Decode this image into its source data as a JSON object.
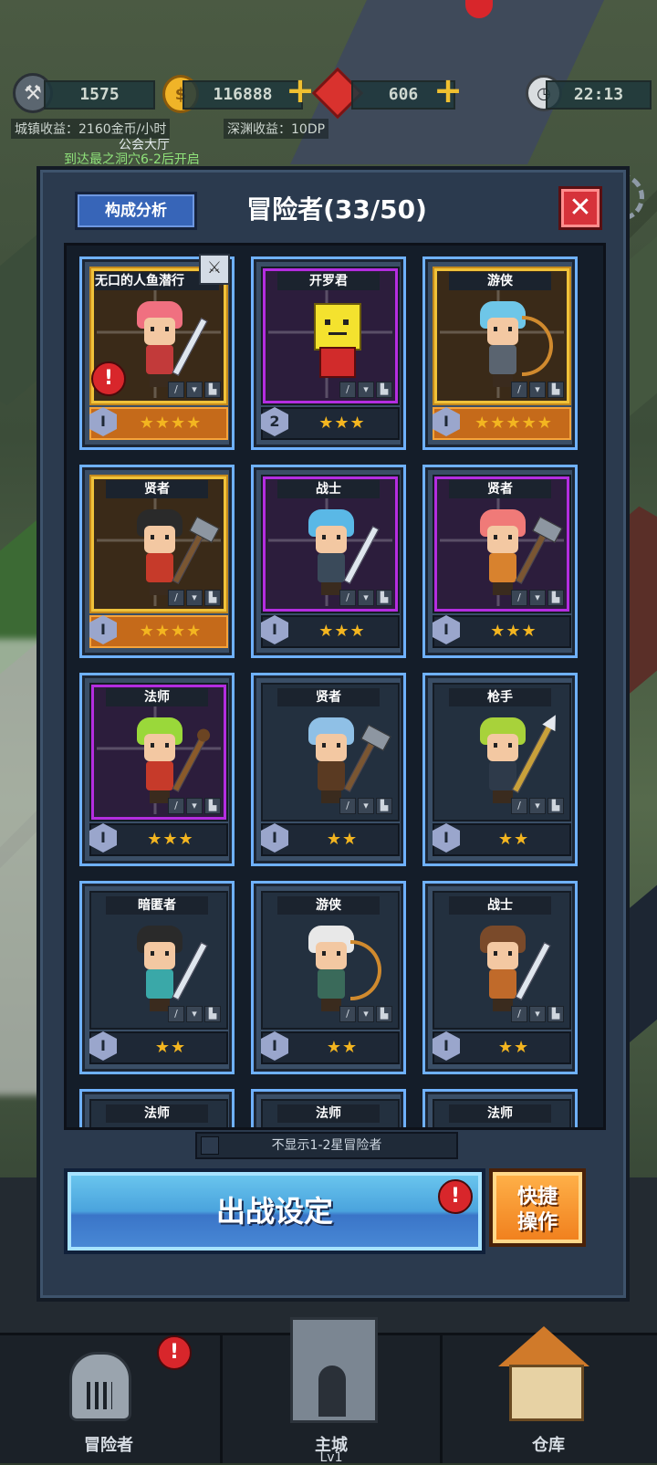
{
  "hud": {
    "resource1": "1575",
    "gold": "116888",
    "gems": "606",
    "time": "22:13",
    "town_income": "城镇收益：2160金币/小时",
    "abyss_income": "深渊收益：10DP",
    "guild_hall": "公会大厅",
    "guild_hint": "到达最之洞穴6-2后开启"
  },
  "panel": {
    "analysis_button": "构成分析",
    "title": "冒险者(33/50)",
    "close": "✕"
  },
  "adventurers": [
    {
      "name": "无口的人鱼潜行",
      "level": "I",
      "stars": "★★★★",
      "rarity": "gold",
      "hair": "#f07080",
      "body": "#c23a3a",
      "weapon": "sword"
    },
    {
      "name": "开罗君",
      "level": "2",
      "stars": "★★★",
      "rarity": "purple",
      "hair": "",
      "body": "",
      "weapon": "robot"
    },
    {
      "name": "游侠",
      "level": "I",
      "stars": "★★★★★",
      "rarity": "gold",
      "hair": "#6ec6e8",
      "body": "#5a6470",
      "weapon": "bow"
    },
    {
      "name": "贤者",
      "level": "I",
      "stars": "★★★★",
      "rarity": "gold",
      "hair": "#2a2a2a",
      "body": "#c63a2a",
      "weapon": "hammer"
    },
    {
      "name": "战士",
      "level": "I",
      "stars": "★★★",
      "rarity": "purple",
      "hair": "#5ab8e6",
      "body": "#3a4a5a",
      "weapon": "sword"
    },
    {
      "name": "贤者",
      "level": "I",
      "stars": "★★★",
      "rarity": "purple",
      "hair": "#f07a78",
      "body": "#d8822e",
      "weapon": "hammer"
    },
    {
      "name": "法师",
      "level": "I",
      "stars": "★★★",
      "rarity": "purple",
      "hair": "#9ad83a",
      "body": "#c63a2a",
      "weapon": "staff"
    },
    {
      "name": "贤者",
      "level": "I",
      "stars": "★★",
      "rarity": "normal",
      "hair": "#8fc0e6",
      "body": "#5a3a22",
      "weapon": "hammer"
    },
    {
      "name": "枪手",
      "level": "I",
      "stars": "★★",
      "rarity": "normal",
      "hair": "#a8d23a",
      "body": "#2e3a4a",
      "weapon": "spear"
    },
    {
      "name": "暗匿者",
      "level": "I",
      "stars": "★★",
      "rarity": "normal",
      "hair": "#2a2a2a",
      "body": "#3aa8a8",
      "weapon": "sword"
    },
    {
      "name": "游侠",
      "level": "I",
      "stars": "★★",
      "rarity": "normal",
      "hair": "#e8e8e8",
      "body": "#3a6a5a",
      "weapon": "bow"
    },
    {
      "name": "战士",
      "level": "I",
      "stars": "★★",
      "rarity": "normal",
      "hair": "#7a4a2a",
      "body": "#c06a2a",
      "weapon": "sword"
    },
    {
      "name": "法师",
      "level": "",
      "stars": "",
      "rarity": "normal",
      "hair": "",
      "body": "",
      "weapon": "none"
    },
    {
      "name": "法师",
      "level": "",
      "stars": "",
      "rarity": "normal",
      "hair": "",
      "body": "",
      "weapon": "none"
    },
    {
      "name": "法师",
      "level": "",
      "stars": "",
      "rarity": "normal",
      "hair": "",
      "body": "",
      "weapon": "none"
    }
  ],
  "footer": {
    "filter_label": "不显示1-2星冒险者",
    "battle_button": "出战设定",
    "quick_button_line1": "快捷",
    "quick_button_line2": "操作",
    "warn_mark": "!"
  },
  "nav": {
    "adventurers": "冒险者",
    "main_city": "主城",
    "main_city_level": "Lv1",
    "warehouse": "仓库"
  }
}
